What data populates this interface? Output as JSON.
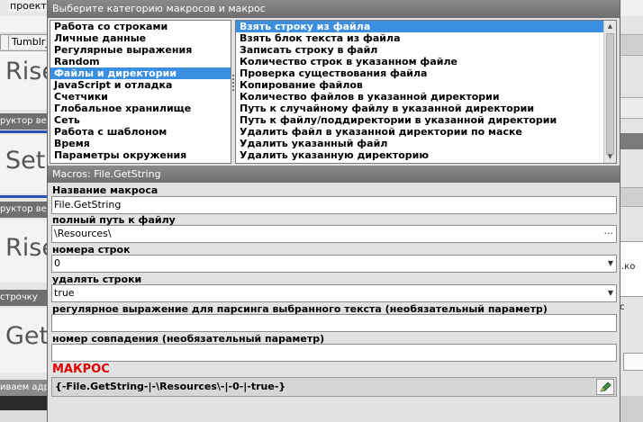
{
  "background": {
    "left_tab_label": "проект",
    "left_tab": "Tumblr_",
    "left_header_1": "руктор ве",
    "left_header_2": "руктор вет",
    "left_header_3": "строчку",
    "left_footer": "иваем адр",
    "big_words": [
      "Rise",
      "Set",
      "Rise",
      "Get"
    ],
    "right_texts": [
      ".ко",
      "с"
    ]
  },
  "dialog": {
    "title": "Выберите категорию макросов и макрос",
    "categories": [
      "Работа со строками",
      "Личные данные",
      "Регулярные выражения",
      "Random",
      "Файлы и директории",
      "JavaScript и отладка",
      "Счетчики",
      "Глобальное хранилище",
      "Сеть",
      "Работа с шаблоном",
      "Время",
      "Параметры окружения"
    ],
    "selected_category_index": 4,
    "macros": [
      "Взять строку из файла",
      "Взять блок текста из файла",
      "Записать строку в файл",
      "Количество строк в указанном файле",
      "Проверка существования файла",
      "Копирование файлов",
      "Количество файлов в указанной директории",
      "Путь к случайному файлу в указанной директории",
      "Путь к файлу/поддиректории в указанной директории",
      "Удалить файл в указанной директории по маске",
      "Удалить указанный файл",
      "Удалить указанную директорию"
    ],
    "selected_macro_index": 0,
    "macros_header": "Macros: File.GetString",
    "name_label": "Название макроса",
    "name_value": "File.GetString",
    "path_label": "полный путь к файлу",
    "path_value": "\\Resources\\",
    "path_button": "···",
    "lines_label": "номера строк",
    "lines_value": "0",
    "delete_label": "удалять строки",
    "delete_value": "true",
    "regex_label": "регулярное выражение для парсинга выбранного текста (необязательный параметр)",
    "regex_value": "",
    "match_label": "номер совпадения (необязательный параметр)",
    "match_value": "",
    "macro_label": "МАКРОС",
    "macro_value": "{-File.GetString-|-\\Resources\\-|-0-|-true-}",
    "dropdown_icon": "chevron-down-icon",
    "colors": {
      "selection": "#3b8fe3",
      "macro_label": "#e00000",
      "title_bar": "#7c7c7c"
    }
  }
}
